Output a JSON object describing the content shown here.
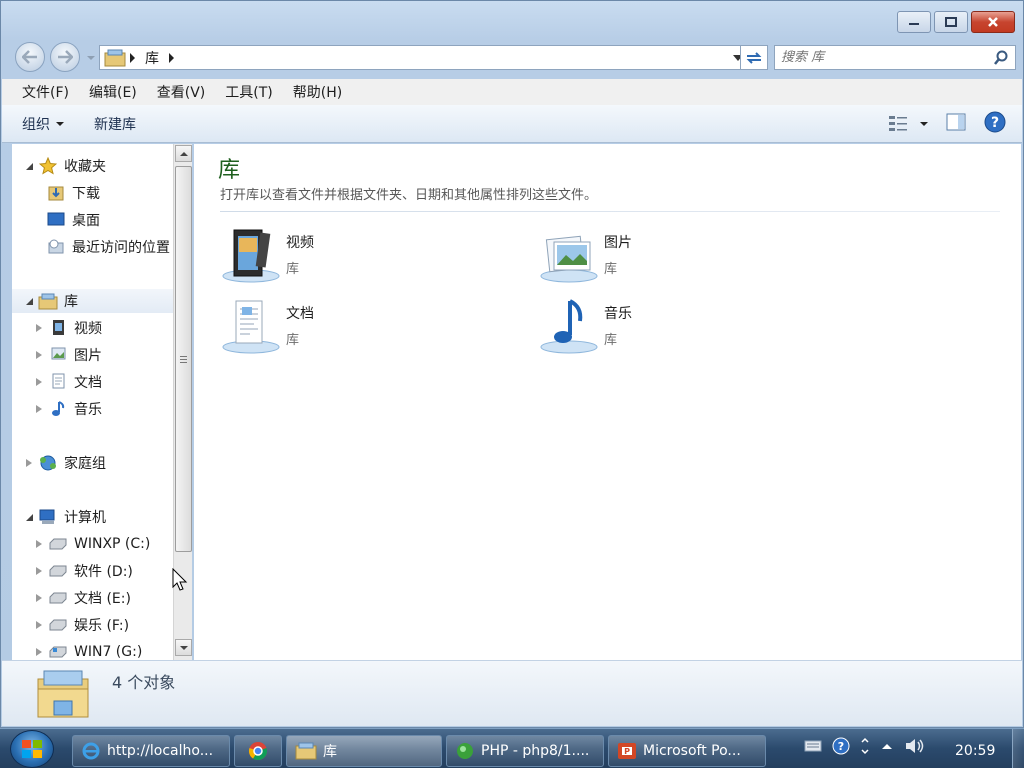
{
  "window": {
    "caption_buttons": {
      "minimize": "minimize-icon",
      "maximize": "maximize-icon",
      "close": "close-icon"
    }
  },
  "address": {
    "crumb": "库",
    "search_placeholder": "搜索 库"
  },
  "menubar": {
    "items": [
      "文件(F)",
      "编辑(E)",
      "查看(V)",
      "工具(T)",
      "帮助(H)"
    ]
  },
  "commandbar": {
    "organize_label": "组织",
    "new_library_label": "新建库"
  },
  "navpane": {
    "favorites": {
      "label": "收藏夹",
      "items": [
        "下载",
        "桌面",
        "最近访问的位置"
      ]
    },
    "libraries": {
      "label": "库",
      "items": [
        "视频",
        "图片",
        "文档",
        "音乐"
      ]
    },
    "homegroup": {
      "label": "家庭组"
    },
    "computer": {
      "label": "计算机",
      "items": [
        "WINXP (C:)",
        "软件 (D:)",
        "文档 (E:)",
        "娱乐 (F:)",
        "WIN7 (G:)"
      ]
    }
  },
  "content": {
    "title": "库",
    "description": "打开库以查看文件并根据文件夹、日期和其他属性排列这些文件。",
    "libraries": [
      {
        "name": "视频",
        "type": "库",
        "icon": "video-library-icon"
      },
      {
        "name": "图片",
        "type": "库",
        "icon": "pictures-library-icon"
      },
      {
        "name": "文档",
        "type": "库",
        "icon": "documents-library-icon"
      },
      {
        "name": "音乐",
        "type": "库",
        "icon": "music-library-icon"
      }
    ]
  },
  "details": {
    "count": "4 个对象"
  },
  "taskbar": {
    "buttons": [
      {
        "label": "http://localho...",
        "icon": "ie-icon"
      },
      {
        "label": "",
        "icon": "chrome-icon"
      },
      {
        "label": "库",
        "icon": "library-folder-icon"
      },
      {
        "label": "PHP - php8/1....",
        "icon": "php-icon"
      },
      {
        "label": "Microsoft Po...",
        "icon": "powerpoint-icon"
      }
    ],
    "clock": "20:59"
  },
  "colors": {
    "title_green": "#1e5f1e",
    "accent_blue": "#2a6fb3"
  }
}
